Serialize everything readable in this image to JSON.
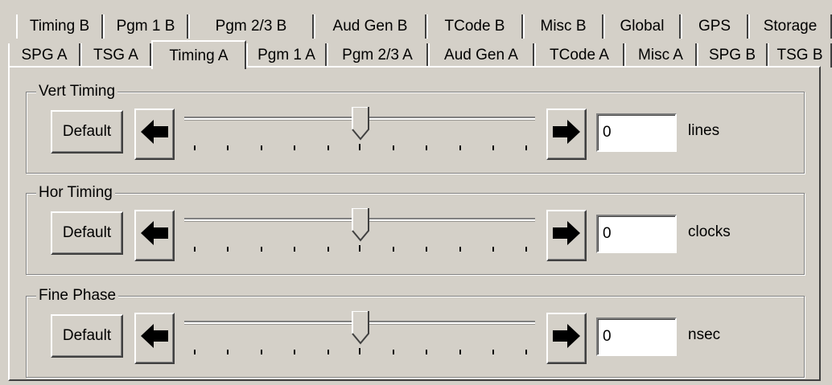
{
  "tabs": {
    "back_row": [
      "Timing B",
      "Pgm 1 B",
      "Pgm 2/3 B",
      "Aud Gen B",
      "TCode B",
      "Misc B",
      "Global",
      "GPS",
      "Storage"
    ],
    "front_row": [
      "SPG A",
      "TSG A",
      "Timing A",
      "Pgm 1 A",
      "Pgm 2/3 A",
      "Aud Gen A",
      "TCode A",
      "Misc A",
      "SPG B",
      "TSG B"
    ],
    "active": "Timing A"
  },
  "groups": [
    {
      "title": "Vert Timing",
      "default_label": "Default",
      "value": "0",
      "unit": "lines",
      "slider_value": 50
    },
    {
      "title": "Hor Timing",
      "default_label": "Default",
      "value": "0",
      "unit": "clocks",
      "slider_value": 50
    },
    {
      "title": "Fine Phase",
      "default_label": "Default",
      "value": "0",
      "unit": "nsec",
      "slider_value": 50
    }
  ],
  "icons": {
    "left": "arrow-left-icon",
    "right": "arrow-right-icon"
  }
}
